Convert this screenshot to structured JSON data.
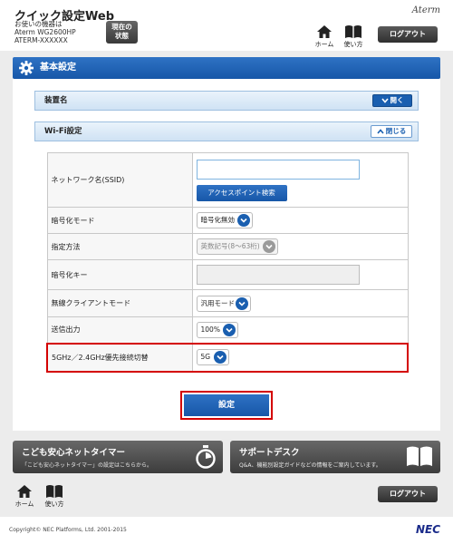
{
  "header": {
    "app_title": "クイック設定Web",
    "device_label": "お使いの機器は",
    "device_model": "Aterm WG2600HP",
    "device_id": "ATERM-XXXXXX",
    "status_button": "現在の\n状態",
    "brand": "Aterm",
    "home_label": "ホーム",
    "guide_label": "使い方",
    "logout_label": "ログアウト"
  },
  "section": {
    "title": "基本設定"
  },
  "accordions": [
    {
      "title": "装置名",
      "button": "開く",
      "state": "closed"
    },
    {
      "title": "Wi-Fi設定",
      "button": "閉じる",
      "state": "open"
    }
  ],
  "settings": {
    "ssid_label": "ネットワーク名(SSID)",
    "ssid_value": "",
    "ap_search_button": "アクセスポイント検索",
    "encryption_label": "暗号化モード",
    "encryption_value": "暗号化無効",
    "method_label": "指定方法",
    "method_value": "英数記号(8～63桁)",
    "key_label": "暗号化キー",
    "key_value": "",
    "client_mode_label": "無線クライアントモード",
    "client_mode_value": "汎用モード",
    "power_label": "送信出力",
    "power_value": "100%",
    "band_label": "5GHz／2.4GHz優先接続切替",
    "band_value": "5G"
  },
  "submit_label": "設定",
  "cards": [
    {
      "title": "こども安心ネットタイマー",
      "subtitle": "「こども安心ネットタイマー」の設定はこちらから。",
      "icon": "stopwatch-icon"
    },
    {
      "title": "サポートデスク",
      "subtitle": "Q&A、機能別設定ガイドなどの情報をご案内しています。",
      "icon": "book-icon"
    }
  ],
  "footer": {
    "home_label": "ホーム",
    "guide_label": "使い方",
    "logout_label": "ログアウト",
    "copyright": "Copyright© NEC Platforms, Ltd. 2001-2015",
    "logo": "NEC"
  },
  "colors": {
    "accent": "#1a5fb0",
    "highlight": "#d40000",
    "dark_button": "#3c3c3c"
  }
}
